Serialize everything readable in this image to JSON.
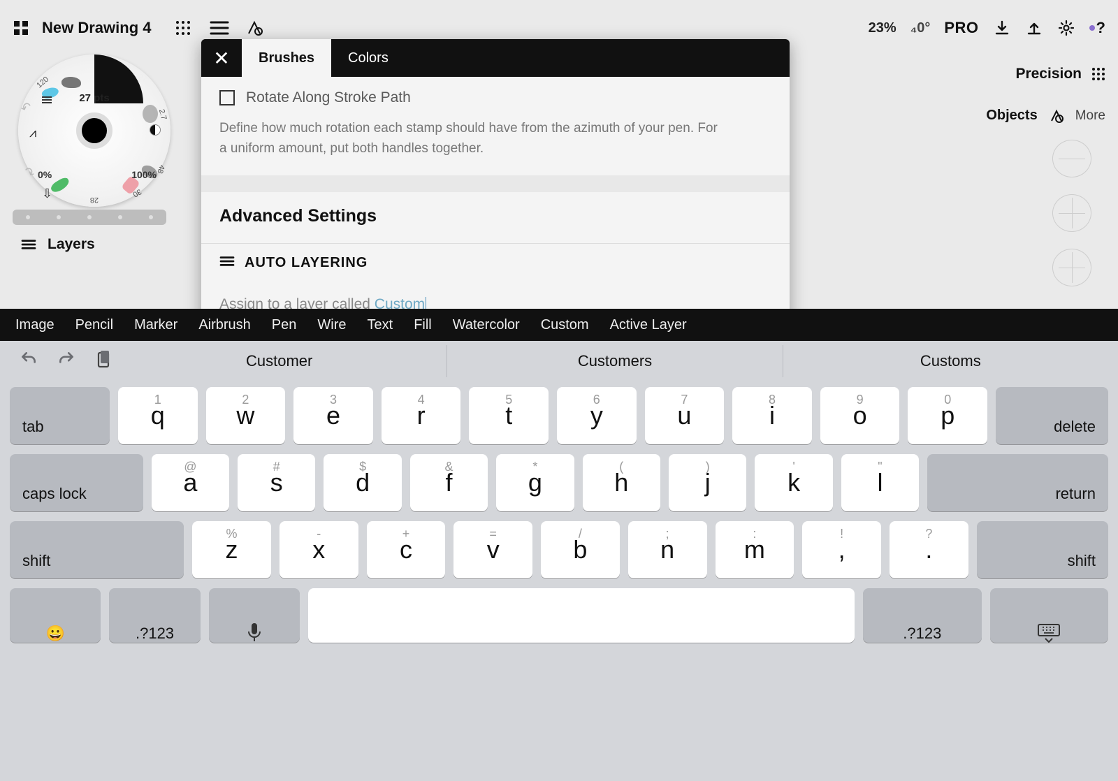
{
  "topbar": {
    "title": "New Drawing 4",
    "zoom": "23%",
    "angle": "₄0°",
    "pro": "PRO"
  },
  "wheel": {
    "pts": "27 pts",
    "zero": "0%",
    "hundred": "100%",
    "n120": "120",
    "n27": "27",
    "n27b": "2.7",
    "n48": "48",
    "n30": "30",
    "n28": "28"
  },
  "layers_label": "Layers",
  "precision_label": "Precision",
  "objects_label": "Objects",
  "more_label": "More",
  "panel": {
    "tab_brushes": "Brushes",
    "tab_colors": "Colors",
    "checkbox_label": "Rotate Along Stroke Path",
    "description": "Define how much rotation each stamp should have from the azimuth of your pen. For a uniform amount, put both handles together.",
    "section_title": "Advanced Settings",
    "auto_layering": "AUTO LAYERING",
    "assign_prefix": "Assign to a layer called ",
    "assign_value": "Custom"
  },
  "suggestion_categories": [
    "Image",
    "Pencil",
    "Marker",
    "Airbrush",
    "Pen",
    "Wire",
    "Text",
    "Fill",
    "Watercolor",
    "Custom",
    "Active Layer"
  ],
  "predictions": [
    "Customer",
    "Customers",
    "Customs"
  ],
  "keys": {
    "tab": "tab",
    "delete": "delete",
    "caps": "caps lock",
    "return": "return",
    "shift": "shift",
    "numswitch": ".?123",
    "row1": [
      {
        "m": "q",
        "s": "1"
      },
      {
        "m": "w",
        "s": "2"
      },
      {
        "m": "e",
        "s": "3"
      },
      {
        "m": "r",
        "s": "4"
      },
      {
        "m": "t",
        "s": "5"
      },
      {
        "m": "y",
        "s": "6"
      },
      {
        "m": "u",
        "s": "7"
      },
      {
        "m": "i",
        "s": "8"
      },
      {
        "m": "o",
        "s": "9"
      },
      {
        "m": "p",
        "s": "0"
      }
    ],
    "row2": [
      {
        "m": "a",
        "s": "@"
      },
      {
        "m": "s",
        "s": "#"
      },
      {
        "m": "d",
        "s": "$"
      },
      {
        "m": "f",
        "s": "&"
      },
      {
        "m": "g",
        "s": "*"
      },
      {
        "m": "h",
        "s": "("
      },
      {
        "m": "j",
        "s": ")"
      },
      {
        "m": "k",
        "s": "'"
      },
      {
        "m": "l",
        "s": "\""
      }
    ],
    "row3": [
      {
        "m": "z",
        "s": "%"
      },
      {
        "m": "x",
        "s": "-"
      },
      {
        "m": "c",
        "s": "+"
      },
      {
        "m": "v",
        "s": "="
      },
      {
        "m": "b",
        "s": "/"
      },
      {
        "m": "n",
        "s": ";"
      },
      {
        "m": "m",
        "s": ":"
      },
      {
        "m": ",",
        "s": "!"
      },
      {
        "m": ".",
        "s": "?"
      }
    ]
  }
}
